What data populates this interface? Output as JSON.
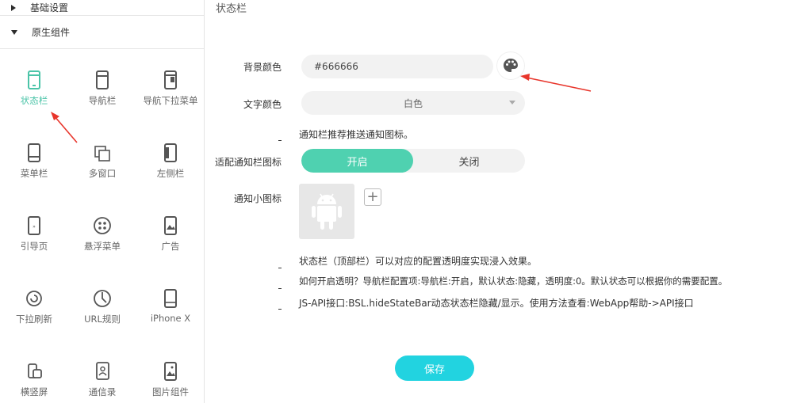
{
  "sidebar": {
    "sections": [
      {
        "label": "基础设置",
        "expanded": false
      },
      {
        "label": "原生组件",
        "expanded": true
      }
    ],
    "items": [
      {
        "label": "状态栏",
        "icon": "phone-statusbar-icon",
        "active": true
      },
      {
        "label": "导航栏",
        "icon": "phone-navbar-icon",
        "active": false
      },
      {
        "label": "导航下拉菜单",
        "icon": "phone-dropdown-icon",
        "active": false
      },
      {
        "label": "菜单栏",
        "icon": "phone-menubar-icon",
        "active": false
      },
      {
        "label": "多窗口",
        "icon": "multi-window-icon",
        "active": false
      },
      {
        "label": "左侧栏",
        "icon": "phone-leftbar-icon",
        "active": false
      },
      {
        "label": "引导页",
        "icon": "phone-guide-icon",
        "active": false
      },
      {
        "label": "悬浮菜单",
        "icon": "float-menu-icon",
        "active": false
      },
      {
        "label": "广告",
        "icon": "ad-icon",
        "active": false
      },
      {
        "label": "下拉刷新",
        "icon": "pull-refresh-icon",
        "active": false
      },
      {
        "label": "URL规则",
        "icon": "url-rule-icon",
        "active": false
      },
      {
        "label": "iPhone X",
        "icon": "iphone-x-icon",
        "active": false
      },
      {
        "label": "横竖屏",
        "icon": "rotate-screen-icon",
        "active": false
      },
      {
        "label": "通信录",
        "icon": "contacts-icon",
        "active": false
      },
      {
        "label": "图片组件",
        "icon": "image-component-icon",
        "active": false
      }
    ]
  },
  "main": {
    "title": "状态栏",
    "bg_color": {
      "label": "背景颜色",
      "value": "#666666"
    },
    "text_color": {
      "label": "文字颜色",
      "selected": "白色"
    },
    "notify_hint": "通知栏推荐推送通知图标。",
    "notify_toggle": {
      "label": "适配通知栏图标",
      "on_label": "开启",
      "off_label": "关闭",
      "value": "on"
    },
    "notify_icon": {
      "label": "通知小图标",
      "add_symbol": "+"
    },
    "notes": [
      "状态栏（顶部栏）可以对应的配置透明度实现浸入效果。",
      "如何开启透明？导航栏配置项:导航栏:开启，默认状态:隐藏，透明度:0。默认状态可以根据你的需要配置。",
      "JS-API接口:BSL.hideStateBar动态状态栏隐藏/显示。使用方法查看:WebApp帮助->API接口"
    ],
    "save_label": "保存"
  },
  "colors": {
    "accent": "#4fd1b0",
    "save": "#22d3e0",
    "active_text": "#4bc4a8",
    "arrow": "#e8352b"
  }
}
